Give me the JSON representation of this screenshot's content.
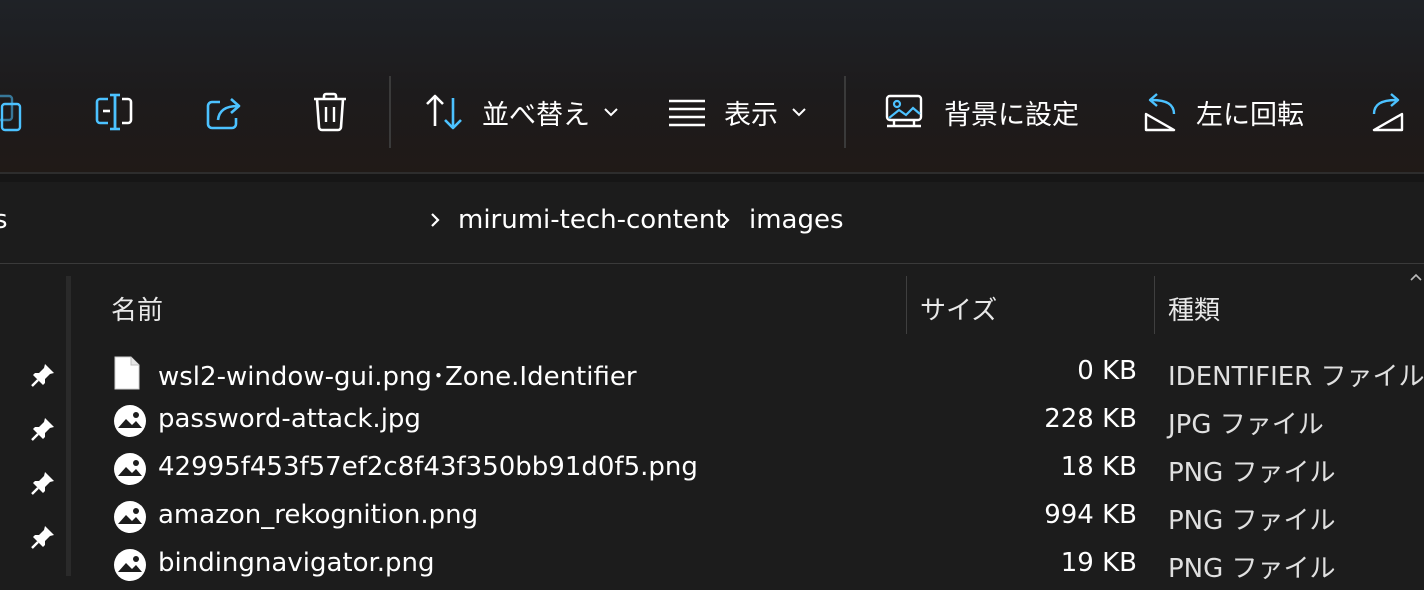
{
  "toolbar": {
    "sort_label": "並べ替え",
    "view_label": "表示",
    "set_background_label": "背景に設定",
    "rotate_left_label": "左に回転"
  },
  "breadcrumb": {
    "partial": "s",
    "items": [
      "mirumi-tech-content",
      "images"
    ]
  },
  "columns": {
    "name": "名前",
    "size": "サイズ",
    "type": "種類"
  },
  "files": [
    {
      "name": "wsl2-window-gui.png･Zone.Identifier",
      "size": "0 KB",
      "type": "IDENTIFIER ファイル",
      "icon": "file-icon"
    },
    {
      "name": "password-attack.jpg",
      "size": "228 KB",
      "type": "JPG ファイル",
      "icon": "image-icon"
    },
    {
      "name": "42995f453f57ef2c8f43f350bb91d0f5.png",
      "size": "18 KB",
      "type": "PNG ファイル",
      "icon": "image-icon"
    },
    {
      "name": "amazon_rekognition.png",
      "size": "994 KB",
      "type": "PNG ファイル",
      "icon": "image-icon"
    },
    {
      "name": "bindingnavigator.png",
      "size": "19 KB",
      "type": "PNG ファイル",
      "icon": "image-icon"
    }
  ],
  "colors": {
    "accent": "#4cc2ff",
    "background": "#1c1c1c",
    "text": "#ffffff"
  }
}
